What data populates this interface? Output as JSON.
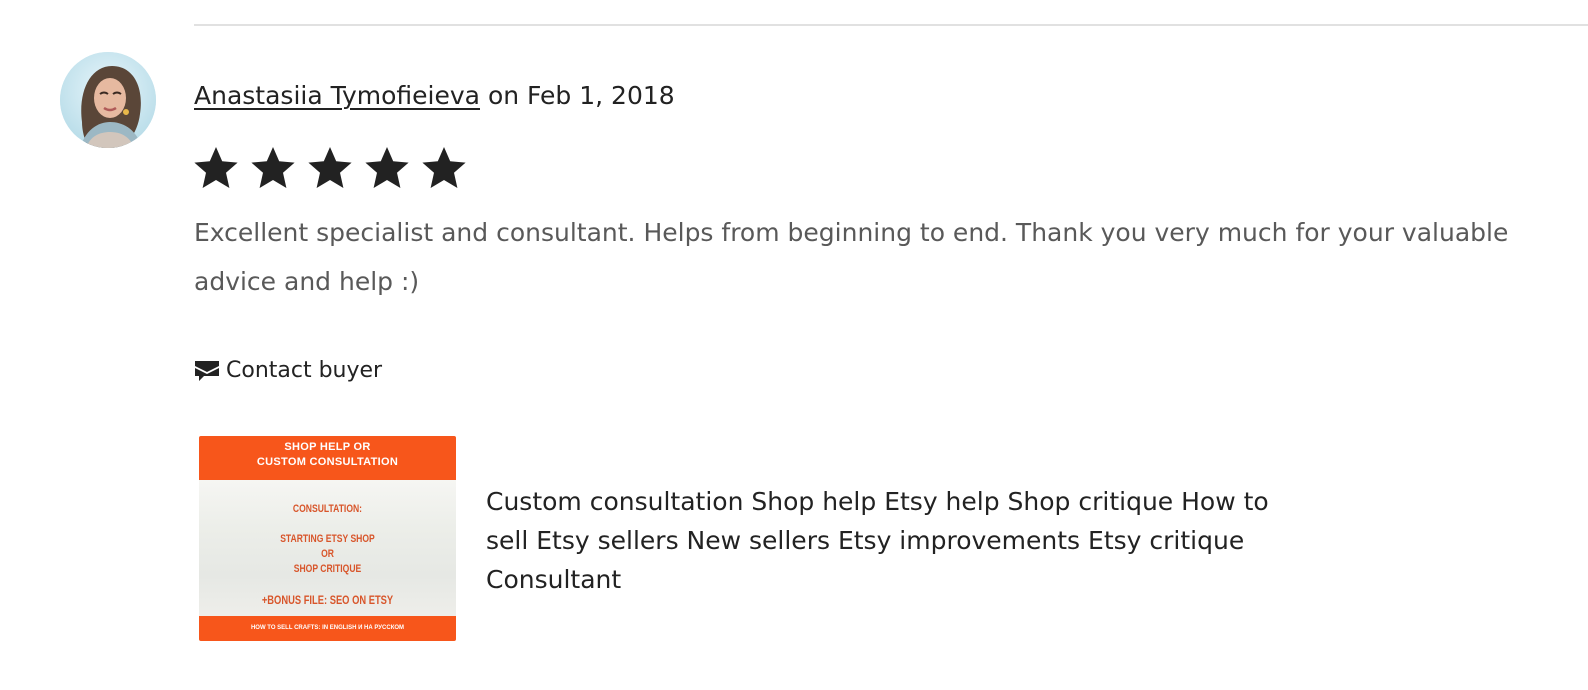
{
  "review": {
    "reviewer_name": "Anastasiia Tymofieieva",
    "date_text": "on Feb 1, 2018",
    "rating": 5,
    "rating_max": 5,
    "text": "Excellent specialist and consultant. Helps from beginning to end. Thank you very much for your valuable advice and help :)"
  },
  "actions": {
    "contact_label": "Contact buyer",
    "contact_icon": "message-icon"
  },
  "listing": {
    "thumb": {
      "header_line1": "SHOP  HELP OR",
      "header_line2": "CUSTOM CONSULTATION",
      "line1": "CONSULTATION:",
      "line2": "STARTING ETSY SHOP",
      "line3": "OR",
      "line4": "SHOP CRITIQUE",
      "line5": "+BONUS  FILE: SEO ON ETSY",
      "footer": "HOW TO SELL CRAFTS: IN ENGLISH И НА РУССКОМ"
    },
    "title": "Custom consultation Shop help Etsy help Shop critique How to sell Etsy sellers New sellers Etsy improvements Etsy critique Consultant"
  },
  "colors": {
    "accent_orange": "#f7561b",
    "text_dark": "#222222",
    "text_muted": "#595959"
  }
}
